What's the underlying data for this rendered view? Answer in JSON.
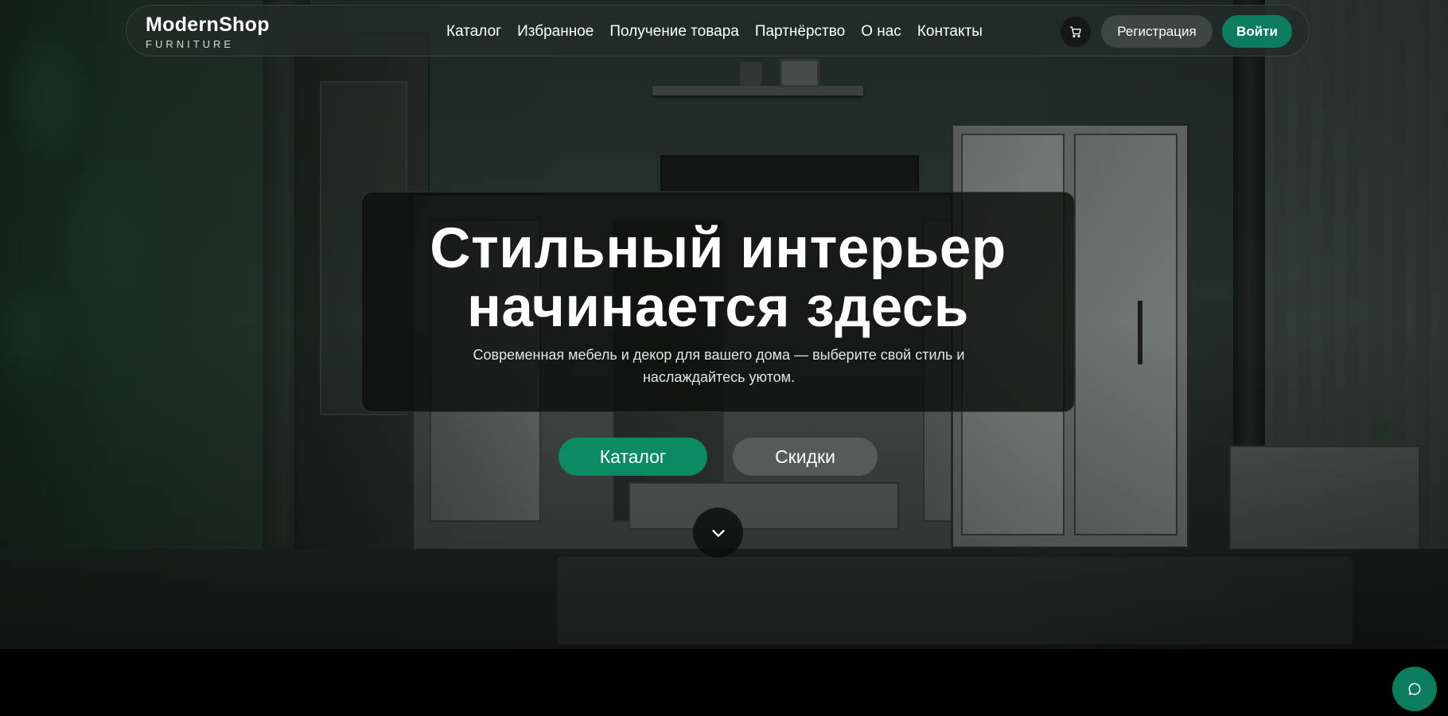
{
  "brand": {
    "name": "ModernShop",
    "tagline": "FURNITURE"
  },
  "nav": {
    "links": [
      {
        "label": "Каталог"
      },
      {
        "label": "Избранное"
      },
      {
        "label": "Получение товара"
      },
      {
        "label": "Партнёрство"
      },
      {
        "label": "О нас"
      },
      {
        "label": "Контакты"
      }
    ],
    "cart_icon": "cart-icon",
    "register_label": "Регистрация",
    "login_label": "Войти"
  },
  "hero": {
    "title_line1": "Стильный интерьер",
    "title_line2": "начинается здесь",
    "subtitle_line1": "Современная мебель и декор для вашего дома — выберите свой стиль и",
    "subtitle_line2": "наслаждайтесь уютом.",
    "catalog_button": "Каталог",
    "discounts_button": "Скидки",
    "scroll_icon": "chevron-down-icon"
  },
  "chat": {
    "icon": "chat-bubble-icon"
  },
  "colors": {
    "accent": "#0c7d5c",
    "accent_bright": "#0c8a62",
    "navbar_bg": "#222c28",
    "secondary_button": "#3e4643"
  }
}
